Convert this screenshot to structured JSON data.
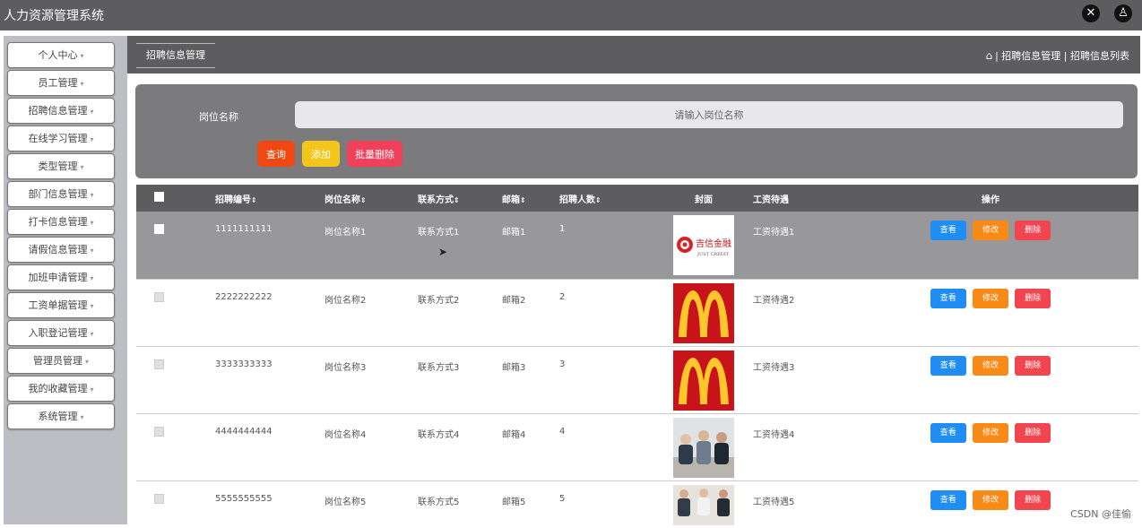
{
  "app": {
    "title": "人力资源管理系统"
  },
  "topbar": {
    "icons": [
      "fullscreen-icon",
      "user-icon"
    ]
  },
  "sidebar": {
    "items": [
      {
        "label": "个人中心"
      },
      {
        "label": "员工管理"
      },
      {
        "label": "招聘信息管理"
      },
      {
        "label": "在线学习管理"
      },
      {
        "label": "类型管理"
      },
      {
        "label": "部门信息管理"
      },
      {
        "label": "打卡信息管理"
      },
      {
        "label": "请假信息管理"
      },
      {
        "label": "加班申请管理"
      },
      {
        "label": "工资单据管理"
      },
      {
        "label": "入职登记管理"
      },
      {
        "label": "管理员管理"
      },
      {
        "label": "我的收藏管理"
      },
      {
        "label": "系统管理"
      }
    ]
  },
  "breadcrumb": {
    "tab": "招聘信息管理",
    "path": "| 招聘信息管理 | 招聘信息列表"
  },
  "search": {
    "label": "岗位名称",
    "placeholder": "请输入岗位名称",
    "query": "查询",
    "add": "添加",
    "batch_delete": "批量删除"
  },
  "table": {
    "headers": {
      "code": "招聘编号",
      "position": "岗位名称",
      "contact": "联系方式",
      "email": "邮箱",
      "count": "招聘人数",
      "cover": "封面",
      "salary": "工资待遇",
      "ops": "操作"
    },
    "actions": {
      "view": "查看",
      "edit": "修改",
      "delete": "删除"
    },
    "rows": [
      {
        "code": "1111111111",
        "position": "岗位名称1",
        "contact": "联系方式1",
        "email": "邮箱1",
        "count": "1",
        "cover": "jixin-logo",
        "salary": "工资待遇1"
      },
      {
        "code": "2222222222",
        "position": "岗位名称2",
        "contact": "联系方式2",
        "email": "邮箱2",
        "count": "2",
        "cover": "mcdonalds-logo",
        "salary": "工资待遇2"
      },
      {
        "code": "3333333333",
        "position": "岗位名称3",
        "contact": "联系方式3",
        "email": "邮箱3",
        "count": "3",
        "cover": "mcdonalds-logo",
        "salary": "工资待遇3"
      },
      {
        "code": "4444444444",
        "position": "岗位名称4",
        "contact": "联系方式4",
        "email": "邮箱4",
        "count": "4",
        "cover": "business-people-photo",
        "salary": "工资待遇4"
      },
      {
        "code": "5555555555",
        "position": "岗位名称5",
        "contact": "联系方式5",
        "email": "邮箱5",
        "count": "5",
        "cover": "meeting-photo",
        "salary": "工资待遇5"
      }
    ]
  },
  "cover_images": {
    "jixin": {
      "cn": "吉信金融",
      "en": "JUST CREDIT"
    }
  },
  "watermark": "CSDN @佳偷",
  "colors": {
    "topbar": "#5d5c5f",
    "query": "#f04812",
    "add": "#f3c61a",
    "batch": "#f0405a",
    "view": "#1f8df1",
    "edit": "#f98a16",
    "delete": "#f14650"
  }
}
